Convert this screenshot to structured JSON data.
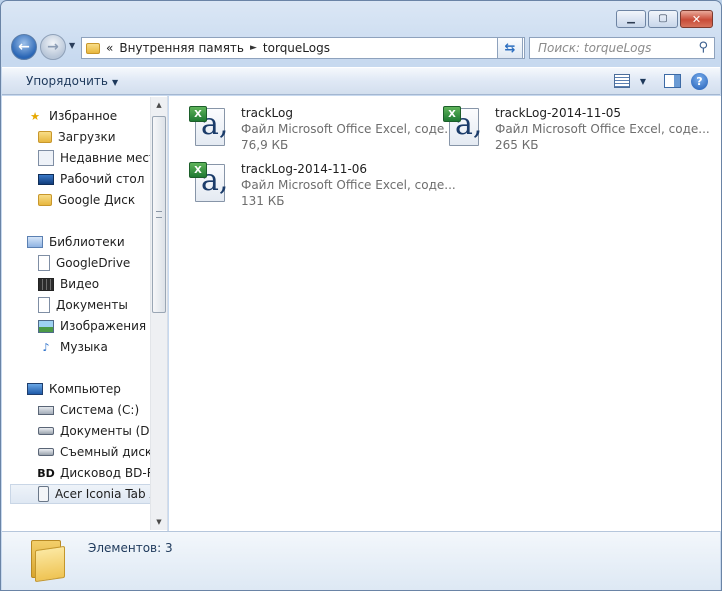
{
  "window": {
    "caption": {
      "minimize_icon": "minimize-icon",
      "maximize_icon": "maximize-icon",
      "close_icon": "close-icon"
    }
  },
  "address_bar": {
    "overflow": "«",
    "crumbs": [
      "Внутренняя память",
      "torqueLogs"
    ]
  },
  "search": {
    "placeholder": "Поиск: torqueLogs"
  },
  "toolbar": {
    "organize_label": "Упорядочить"
  },
  "nav": {
    "favorites": {
      "label": "Избранное",
      "items": [
        "Загрузки",
        "Недавние места",
        "Рабочий стол",
        "Google Диск"
      ]
    },
    "libraries": {
      "label": "Библиотеки",
      "items": [
        "GoogleDrive",
        "Видео",
        "Документы",
        "Изображения",
        "Музыка"
      ]
    },
    "computer": {
      "label": "Компьютер",
      "items": [
        "Система (C:)",
        "Документы (D:)",
        "Съемный диск (",
        "Дисковод BD-RO",
        "Acer Iconia Tab A"
      ]
    }
  },
  "files": [
    {
      "name": "trackLog",
      "type": "Файл Microsoft Office Excel, соде...",
      "size": "76,9 КБ"
    },
    {
      "name": "trackLog-2014-11-05",
      "type": "Файл Microsoft Office Excel, соде...",
      "size": "265 КБ"
    },
    {
      "name": "trackLog-2014-11-06",
      "type": "Файл Microsoft Office Excel, соде...",
      "size": "131 КБ"
    }
  ],
  "details": {
    "item_count": "Элементов: 3"
  }
}
